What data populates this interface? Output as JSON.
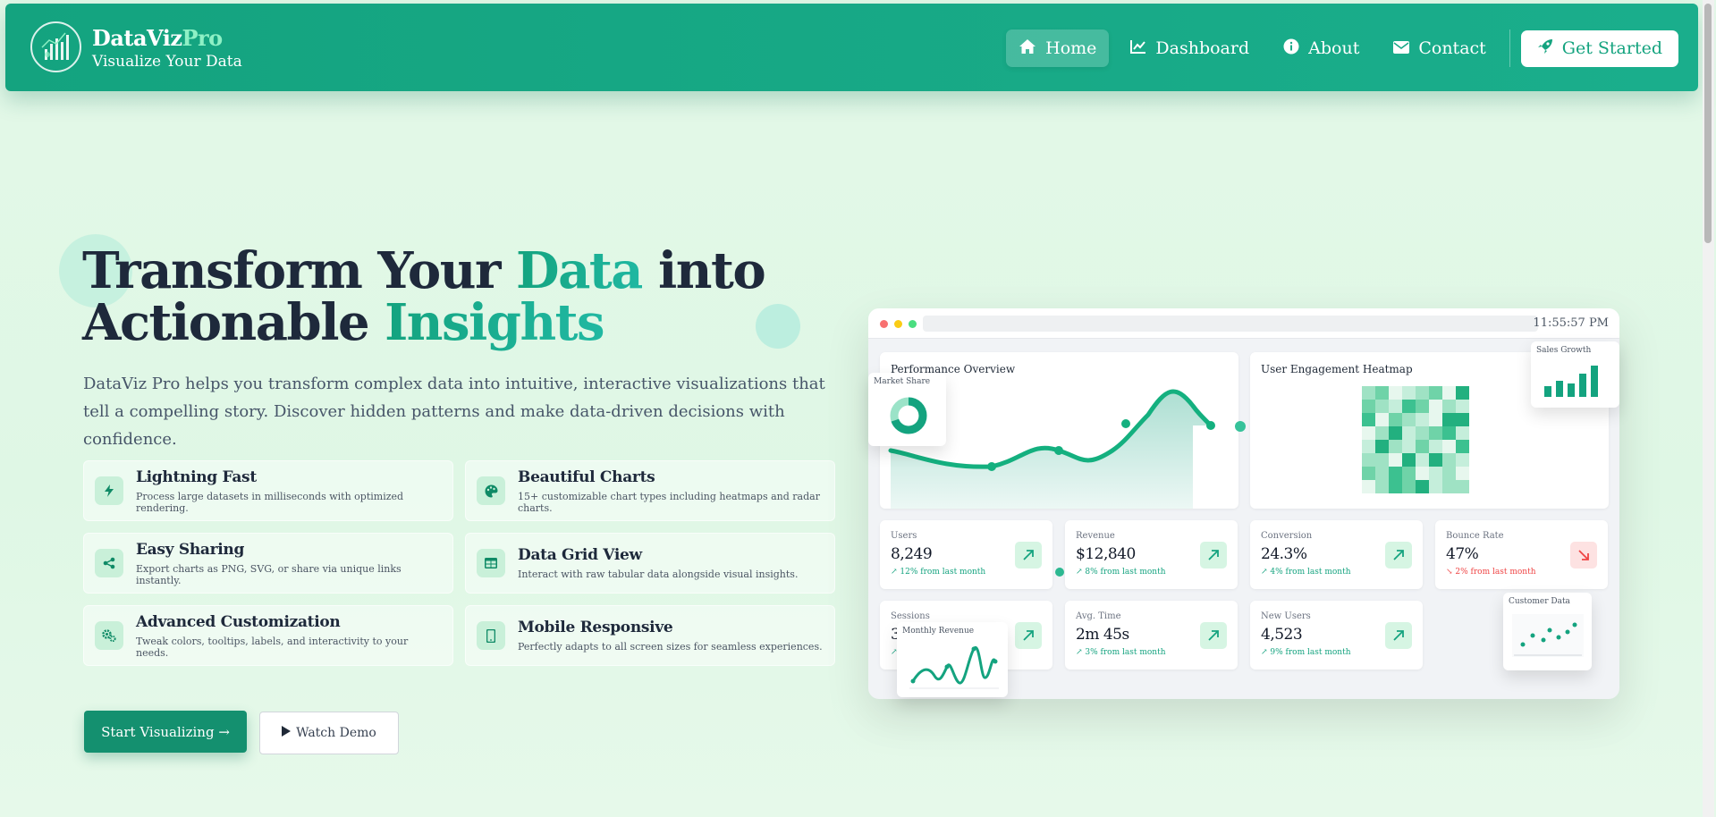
{
  "brand": {
    "name_main": "DataViz",
    "name_accent": "Pro",
    "tagline": "Visualize Your Data",
    "logo_icon": "chart-logo-icon"
  },
  "nav": {
    "items": [
      {
        "label": "Home",
        "icon": "home-icon",
        "active": true
      },
      {
        "label": "Dashboard",
        "icon": "line-chart-icon",
        "active": false
      },
      {
        "label": "About",
        "icon": "info-icon",
        "active": false
      },
      {
        "label": "Contact",
        "icon": "envelope-icon",
        "active": false
      }
    ],
    "cta": {
      "label": "Get Started",
      "icon": "rocket-icon"
    }
  },
  "hero": {
    "title_part1": "Transform Your ",
    "title_accent1": "Data",
    "title_part2": " into",
    "title_part3": "Actionable ",
    "title_accent2": "Insights",
    "description": "DataViz Pro helps you transform complex data into intuitive, interactive visualizations that tell a compelling story. Discover hidden patterns and make data-driven decisions with confidence.",
    "primary_button": "Start Visualizing →",
    "secondary_button": "Watch Demo"
  },
  "features": [
    {
      "title": "Lightning Fast",
      "desc": "Process large datasets in milliseconds with optimized rendering.",
      "icon": "bolt-icon"
    },
    {
      "title": "Beautiful Charts",
      "desc": "15+ customizable chart types including heatmaps and radar charts.",
      "icon": "palette-icon"
    },
    {
      "title": "Easy Sharing",
      "desc": "Export charts as PNG, SVG, or share via unique links instantly.",
      "icon": "share-icon"
    },
    {
      "title": "Data Grid View",
      "desc": "Interact with raw tabular data alongside visual insights.",
      "icon": "table-icon"
    },
    {
      "title": "Advanced Customization",
      "desc": "Tweak colors, tooltips, labels, and interactivity to your needs.",
      "icon": "cogs-icon"
    },
    {
      "title": "Mobile Responsive",
      "desc": "Perfectly adapts to all screen sizes for seamless experiences.",
      "icon": "mobile-icon"
    }
  ],
  "mock": {
    "time": "11:55:57 PM",
    "performance_title": "Performance Overview",
    "heatmap_title": "User Engagement Heatmap",
    "stats_row1": [
      {
        "label": "Users",
        "value": "8,249",
        "change": "↗ 12% from last month",
        "trend": "up"
      },
      {
        "label": "Revenue",
        "value": "$12,840",
        "change": "↗ 8% from last month",
        "trend": "up"
      },
      {
        "label": "Conversion",
        "value": "24.3%",
        "change": "↗ 4% from last month",
        "trend": "up"
      },
      {
        "label": "Bounce Rate",
        "value": "47%",
        "change": "↘ 2% from last month",
        "trend": "down"
      }
    ],
    "stats_row2": [
      {
        "label": "Sessions",
        "value": "3",
        "change": "↗",
        "trend": "up"
      },
      {
        "label": "Avg. Time",
        "value": "2m 45s",
        "change": "↗ 3% from last month",
        "trend": "up"
      },
      {
        "label": "New Users",
        "value": "4,523",
        "change": "↗ 9% from last month",
        "trend": "up"
      }
    ],
    "float_cards": {
      "market_share": "Market Share",
      "sales_growth": "Sales Growth",
      "monthly_revenue": "Monthly Revenue",
      "customer_data": "Customer Data"
    },
    "colors": {
      "accent": "#14a37f",
      "accent_light": "#c9f0d9",
      "danger": "#ef4444"
    }
  }
}
